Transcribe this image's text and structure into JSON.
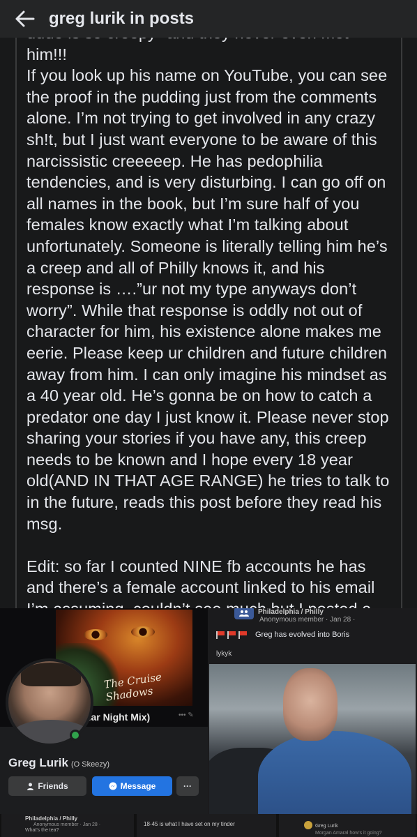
{
  "header": {
    "title": "greg lurik in posts",
    "back_icon": "arrow-left-icon"
  },
  "post": {
    "text": "dude is so creepy\" and they never even met him!!!\nIf you look up his name on YouTube, you can see the proof in the pudding just from the comments alone. I’m not trying to get involved in any crazy sh!t, but I just want everyone to be aware of this narcissistic creeeeep. He has pedophilia tendencies, and is very disturbing. I can go off on all names in the book, but I’m sure half of you females know exactly what I’m talking about unfortunately. Someone is literally telling him he’s a creep and all of Philly knows it, and his response is ….”ur not my type anyways don’t worry”. While that response is oddly not out of character for him, his existence alone makes me eerie. Please keep ur children and future children away from him. I can only imagine his mindset as a 40 year old. He’s gonna be on how to catch a predator one day I just know it. Please never stop sharing your stories if you have any, this creep needs to be known and I hope every 18 year old(AND IN THAT AGE RANGE) he tries to talk to in the future, reads this post before they read his msg.\n\nEdit: so far I counted NINE fb accounts he has and there’s a female account linked to his email I’m assuming, couldn’t see much but I posted a pic just incase!!!!"
  },
  "profile_card": {
    "album_title": "The Cruise Shadows",
    "mix_label": "olar Night Mix)",
    "name": "Greg Lurik",
    "nickname": "(O Skeezy)",
    "friends_label": "Friends",
    "message_label": "Message",
    "more_label": "···"
  },
  "group_post": {
    "group_name": "Philadelphia / Philly",
    "meta": "Anonymous member · Jan 28 ·",
    "title": "Greg has evolved into Boris",
    "subtext": "lykyk"
  },
  "strip": {
    "a_group": "Philadelphia / Philly",
    "a_meta": "Anonymous member · Jan 28 ·",
    "a_line": "What's the tea?",
    "b_line": "18-45 is what I have set on my tinder",
    "c_name": "Greg Lurik",
    "c_line": "Morgan Amaral how's it going?"
  },
  "colors": {
    "background": "#18191a",
    "header": "#242526",
    "message_button": "#2374e1",
    "online": "#31a24c"
  }
}
